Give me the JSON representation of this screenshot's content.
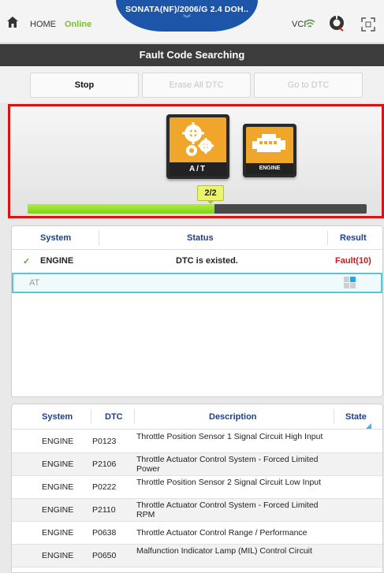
{
  "topbar": {
    "home_label": "HOME",
    "status_label": "Online",
    "vehicle": "SONATA(NF)/2006/G 2.4 DOH..",
    "chevron": "︾",
    "vci_label": "VCI"
  },
  "title": "Fault Code Searching",
  "actions": {
    "stop": "Stop",
    "erase": "Erase All DTC",
    "goto": "Go to DTC"
  },
  "progress": {
    "modules": [
      {
        "label": "A/T",
        "state": "active"
      },
      {
        "label": "ENGINE",
        "state": "done"
      }
    ],
    "counter": "2/2",
    "fraction": 0.55
  },
  "system_table": {
    "headers": {
      "system": "System",
      "status": "Status",
      "result": "Result"
    },
    "rows": [
      {
        "system": "ENGINE",
        "status": "DTC is existed.",
        "result": "Fault(10)",
        "checked": true
      },
      {
        "system": "AT",
        "status": "",
        "result": "",
        "checked": false
      }
    ]
  },
  "dtc_table": {
    "headers": {
      "system": "System",
      "dtc": "DTC",
      "description": "Description",
      "state": "State"
    },
    "rows": [
      {
        "system": "ENGINE",
        "dtc": "P0123",
        "description": "Throttle Position Sensor 1 Signal Circuit High Input"
      },
      {
        "system": "ENGINE",
        "dtc": "P2106",
        "description": "Throttle Actuator Control System - Forced Limited Power"
      },
      {
        "system": "ENGINE",
        "dtc": "P0222",
        "description": "Throttle Position Sensor 2 Signal Circuit Low Input"
      },
      {
        "system": "ENGINE",
        "dtc": "P2110",
        "description": "Throttle Actuator Control System - Forced Limited RPM"
      },
      {
        "system": "ENGINE",
        "dtc": "P0638",
        "description": "Throttle Actuator Control Range / Performance"
      },
      {
        "system": "ENGINE",
        "dtc": "P0650",
        "description": "Malfunction Indicator Lamp (MIL) Control Circuit"
      }
    ]
  },
  "colors": {
    "accent": "#1d56a8",
    "online": "#7bbf2a",
    "fault": "#d21a1a",
    "progress": "#8ee02a",
    "highlight_border": "#e01010",
    "module": "#f0a62a"
  }
}
